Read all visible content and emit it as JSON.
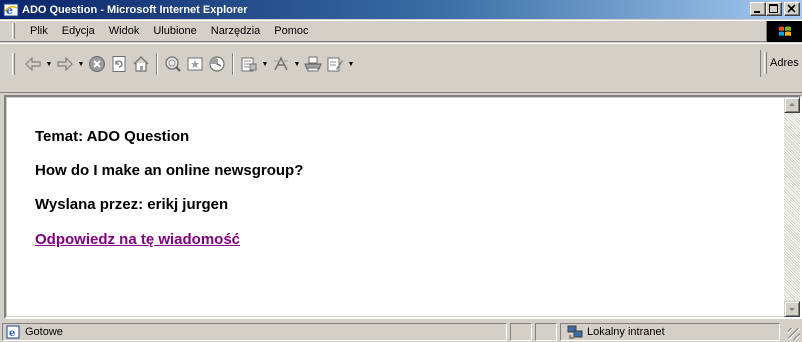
{
  "window": {
    "title": "ADO Question - Microsoft Internet Explorer",
    "minimize_label": "_",
    "maximize_label": "□",
    "close_label": "×"
  },
  "menu": {
    "items": [
      {
        "label": "Plik",
        "key": "file"
      },
      {
        "label": "Edycja",
        "key": "edit"
      },
      {
        "label": "Widok",
        "key": "view"
      },
      {
        "label": "Ulubione",
        "key": "favorites"
      },
      {
        "label": "Narzędzia",
        "key": "tools"
      },
      {
        "label": "Pomoc",
        "key": "help"
      }
    ]
  },
  "toolbar": {
    "buttons": [
      {
        "name": "back-button",
        "icon": "back-arrow-icon"
      },
      {
        "name": "forward-button",
        "icon": "forward-arrow-icon"
      },
      {
        "name": "stop-button",
        "icon": "stop-icon"
      },
      {
        "name": "refresh-button",
        "icon": "refresh-icon"
      },
      {
        "name": "home-button",
        "icon": "home-icon"
      },
      {
        "name": "search-button",
        "icon": "search-icon"
      },
      {
        "name": "favorites-button",
        "icon": "favorites-icon"
      },
      {
        "name": "history-button",
        "icon": "history-icon"
      },
      {
        "name": "mail-button",
        "icon": "mail-icon"
      },
      {
        "name": "encoding-button",
        "icon": "encoding-icon"
      },
      {
        "name": "print-button",
        "icon": "print-icon"
      },
      {
        "name": "edit-button",
        "icon": "edit-icon"
      }
    ],
    "address_label": "Adres"
  },
  "content": {
    "topic": "Temat: ADO Question",
    "question": "How do I make an online newsgroup?",
    "sender": "Wyslana przez: erikj jurgen",
    "reply_link": "Odpowiedz na tę wiadomość"
  },
  "status": {
    "text": "Gotowe",
    "zone": "Lokalny intranet"
  },
  "colors": {
    "titlebar_start": "#0a246a",
    "titlebar_end": "#a6caf0",
    "chrome": "#d4d0c8",
    "link_visited": "#800080"
  }
}
